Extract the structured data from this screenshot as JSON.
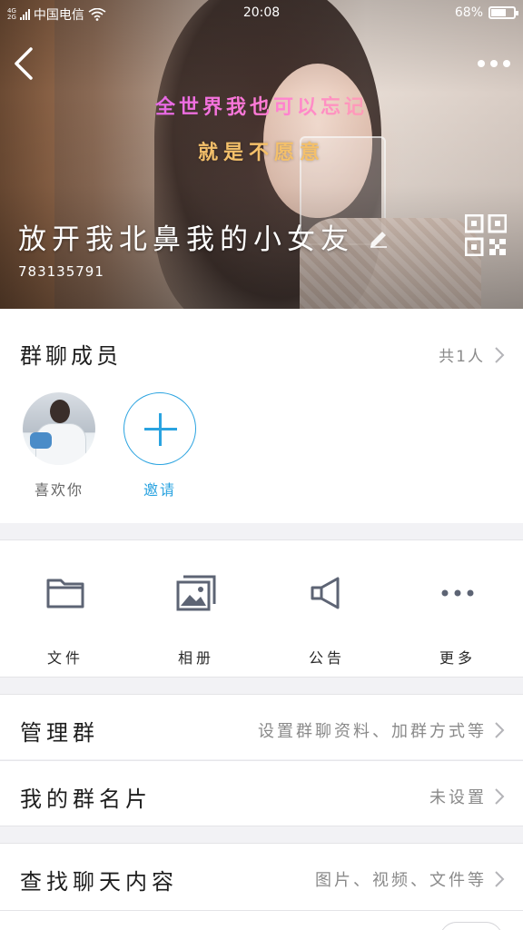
{
  "status_bar": {
    "network_top": "4G",
    "network_bottom": "2G",
    "carrier": "中国电信",
    "time": "20:08",
    "battery": "68%",
    "battery_level": 0.68
  },
  "header": {
    "lyric_line1": "全世界我也可以忘记",
    "lyric_line2": "就是不愿意",
    "group_name": "放开我北鼻我的小女友",
    "group_id": "783135791",
    "icons": {
      "back": "back-arrow-icon",
      "more": "more-dots-icon",
      "edit": "pencil-icon",
      "qr": "qr-code-icon"
    }
  },
  "members": {
    "title": "群聊成员",
    "count": "共1人",
    "list": [
      {
        "label": "喜欢你"
      },
      {
        "label": "邀请"
      }
    ]
  },
  "tools": [
    {
      "label": "文件",
      "icon": "folder-icon"
    },
    {
      "label": "相册",
      "icon": "photo-album-icon"
    },
    {
      "label": "公告",
      "icon": "megaphone-icon"
    },
    {
      "label": "更多",
      "icon": "more-dots-icon"
    }
  ],
  "settings": [
    {
      "title": "管理群",
      "value": "设置群聊资料、加群方式等"
    },
    {
      "title": "我的群名片",
      "value": "未设置"
    },
    {
      "title": "查找聊天内容",
      "value": "图片、视频、文件等"
    }
  ],
  "colors": {
    "accent": "#2aa3e0",
    "icon_gray": "#5d6474",
    "text_gray": "#8a8a8a",
    "page_bg": "#f2f2f5"
  }
}
